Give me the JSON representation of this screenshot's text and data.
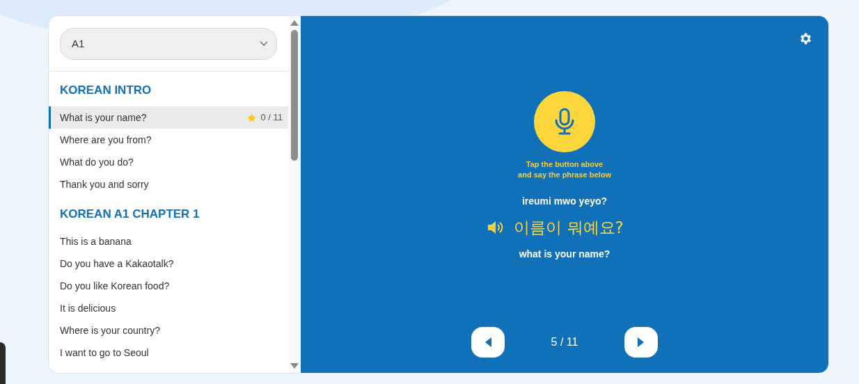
{
  "level_select": {
    "value": "A1"
  },
  "sections": [
    {
      "title": "KOREAN INTRO",
      "lessons": [
        {
          "title": "What is your name?",
          "selected": true,
          "progress": "0 / 11"
        },
        {
          "title": "Where are you from?",
          "selected": false
        },
        {
          "title": "What do you do?",
          "selected": false
        },
        {
          "title": "Thank you and sorry",
          "selected": false
        }
      ]
    },
    {
      "title": "KOREAN A1 CHAPTER 1",
      "lessons": [
        {
          "title": "This is a banana",
          "selected": false
        },
        {
          "title": "Do you have a Kakaotalk?",
          "selected": false
        },
        {
          "title": "Do you like Korean food?",
          "selected": false
        },
        {
          "title": "It is delicious",
          "selected": false
        },
        {
          "title": "Where is your country?",
          "selected": false
        },
        {
          "title": "I want to go to Seoul",
          "selected": false
        }
      ]
    }
  ],
  "practice": {
    "instruction": [
      "Tap the button above",
      "and say the phrase below"
    ],
    "romanization": "ireumi mwo yeyo?",
    "phrase": "이름이 뭐예요?",
    "translation": "what is your name?",
    "counter": "5 / 11"
  }
}
